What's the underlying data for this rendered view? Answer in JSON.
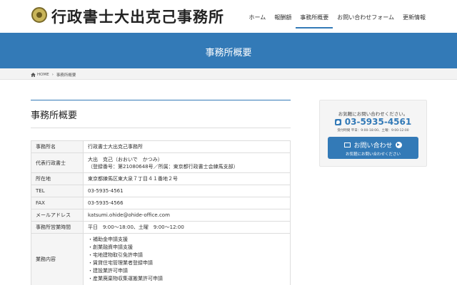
{
  "header": {
    "site_title": "行政書士大出克己事務所",
    "logo_icon": "seal-logo-icon",
    "nav": [
      {
        "label": "ホーム"
      },
      {
        "label": "報酬額"
      },
      {
        "label": "事務所概要",
        "active": true
      },
      {
        "label": "お問い合わせフォーム"
      },
      {
        "label": "更新情報"
      }
    ]
  },
  "banner": {
    "title": "事務所概要"
  },
  "breadcrumb": {
    "home": "HOME",
    "current": "事務所概要"
  },
  "main": {
    "heading": "事務所概要",
    "table": {
      "office_name": {
        "key": "事務所名",
        "value": "行政書士大出克己事務所"
      },
      "representative": {
        "key": "代表行政書士",
        "name": "大出　克己（おおいで　かつみ）",
        "reg": "（登録番号：第21080648号／所属：東京都行政書士会練馬支部）"
      },
      "address": {
        "key": "所在地",
        "value": "東京都練馬区東大泉７丁目４１番地２号"
      },
      "tel": {
        "key": "TEL",
        "value": "03-5935-4561"
      },
      "fax": {
        "key": "FAX",
        "value": "03-5935-4566"
      },
      "email": {
        "key": "メールアドレス",
        "value": "katsumi.ohide@ohide-office.com"
      },
      "hours": {
        "key": "事務所営業時間",
        "value": "平日　9:00～18:00、土曜　9:00～12:00"
      },
      "services": {
        "key": "業務内容",
        "items": [
          "・補助金申請支援",
          "・創業融資申請支援",
          "・宅地建物取引免許申請",
          "・賃貸住宅管理業者登録申請",
          "・建設業許可申請",
          "・産業廃棄物収集運搬業許可申請"
        ]
      }
    }
  },
  "sidebar": {
    "intro": "お気軽にお問い合わせください。",
    "phone": "03-5935-4561",
    "hours": "受付時間 平日：9:00-18:00、土曜：9:00-12:00",
    "button_label": "お問い合わせ",
    "button_sub": "お気軽にお問い合わせください"
  },
  "colors": {
    "accent": "#337ab7",
    "table_key_bg": "#f5f5f5",
    "breadcrumb_bg": "#f3f3f3"
  }
}
